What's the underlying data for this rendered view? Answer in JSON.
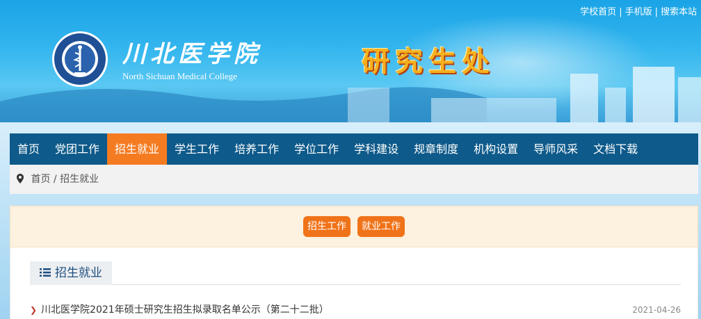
{
  "top_links": {
    "home": "学校首页",
    "mobile": "手机版",
    "search": "搜索本站",
    "separator": "|"
  },
  "school": {
    "name_cn": "川北医学院",
    "name_en": "North Sichuan Medical College",
    "office": "研究生处"
  },
  "nav": {
    "items": [
      {
        "label": "首页",
        "active": false
      },
      {
        "label": "党团工作",
        "active": false
      },
      {
        "label": "招生就业",
        "active": true
      },
      {
        "label": "学生工作",
        "active": false
      },
      {
        "label": "培养工作",
        "active": false
      },
      {
        "label": "学位工作",
        "active": false
      },
      {
        "label": "学科建设",
        "active": false
      },
      {
        "label": "规章制度",
        "active": false
      },
      {
        "label": "机构设置",
        "active": false
      },
      {
        "label": "导师风采",
        "active": false
      },
      {
        "label": "文档下载",
        "active": false
      }
    ]
  },
  "breadcrumb": {
    "home": "首页",
    "separator": "/",
    "current": "招生就业"
  },
  "categories": [
    "招生工作",
    "就业工作"
  ],
  "section": {
    "title": "招生就业"
  },
  "news": [
    {
      "title": "川北医学院2021年硕士研究生招生拟录取名单公示（第二十二批）",
      "date": "2021-04-26"
    }
  ],
  "colors": {
    "nav_bg": "#0e5a8a",
    "accent": "#f57b21",
    "title_gold": "#f5b01e"
  }
}
